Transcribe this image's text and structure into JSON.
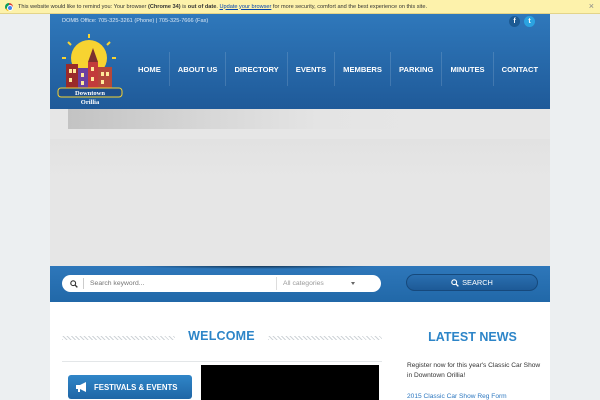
{
  "update_bar": {
    "pre": "This website would like to remind you: Your browser",
    "browser": "(Chrome 34)",
    "is": "is",
    "status": "out of date",
    "period": ".",
    "link": "Update your browser",
    "post": "for more security, comfort and the best experience on this site.",
    "close": "×"
  },
  "header": {
    "contact": "DOMB Office: 705-325-3261 (Phone) | 705-325-7666 (Fax)",
    "social": {
      "facebook": "f",
      "twitter": "t"
    },
    "logo_text": [
      "Downtown",
      "Orillia"
    ]
  },
  "nav": {
    "items": [
      "HOME",
      "ABOUT US",
      "DIRECTORY",
      "EVENTS",
      "MEMBERS",
      "PARKING",
      "MINUTES",
      "CONTACT"
    ]
  },
  "search": {
    "placeholder": "Search keyword...",
    "category": "All categories",
    "button": "SEARCH"
  },
  "main": {
    "welcome_title": "WELCOME",
    "festivals_button": "FESTIVALS & EVENTS"
  },
  "news": {
    "title": "LATEST NEWS",
    "text": "Register now for this year's Classic Car Show in Downtown Orillia!",
    "link": "2015 Classic Car Show Reg Form"
  },
  "colors": {
    "accent": "#2d85c8",
    "header_blue": "#2f78bb",
    "update_bar": "#fdf2ab"
  }
}
